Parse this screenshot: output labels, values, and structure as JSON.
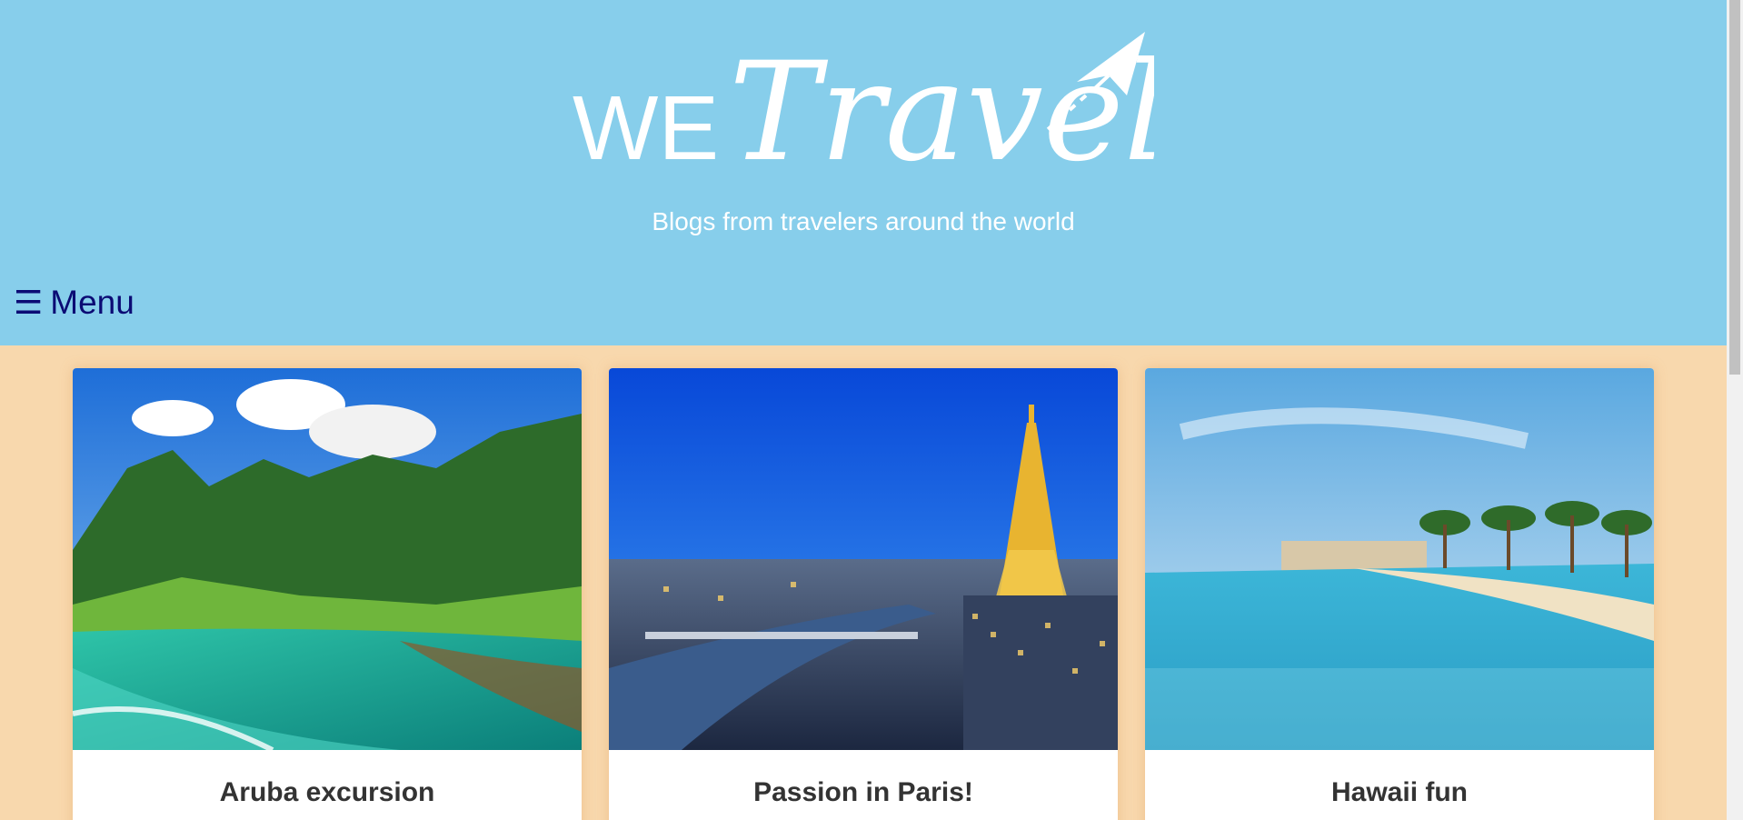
{
  "header": {
    "logo_text_we": "WE",
    "logo_text_travel": "Travel",
    "tagline": "Blogs from travelers around the world",
    "menu_icon": "hamburger-icon",
    "menu_label": "Menu"
  },
  "colors": {
    "header_bg": "#87ceeb",
    "page_bg": "#f8d8ad",
    "menu_text": "#0b0b74",
    "card_bg": "#ffffff"
  },
  "cards": [
    {
      "title": "Aruba excursion",
      "subtitle": "",
      "image": "tropical-mountain-coast-photo"
    },
    {
      "title": "Passion in Paris!",
      "subtitle": "",
      "image": "eiffel-tower-night-photo"
    },
    {
      "title": "Hawaii fun",
      "subtitle": "",
      "image": "beach-resort-photo"
    }
  ]
}
